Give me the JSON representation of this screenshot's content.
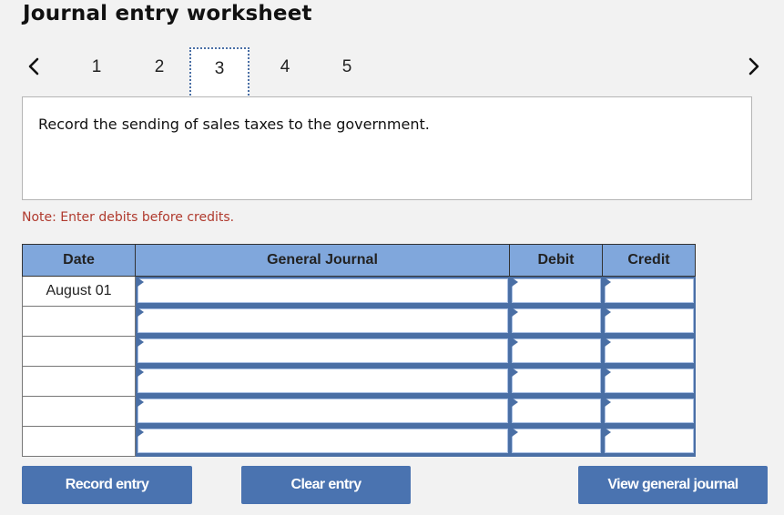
{
  "header": {
    "title": "Journal entry worksheet"
  },
  "pager": {
    "prev_icon": "chevron-left-icon",
    "next_icon": "chevron-right-icon",
    "pages": [
      "1",
      "2",
      "3",
      "4",
      "5"
    ],
    "active_page": "3"
  },
  "prompt": {
    "text": "Record the sending of sales taxes to the government."
  },
  "note": {
    "text": "Note: Enter debits before credits."
  },
  "table": {
    "headers": {
      "date": "Date",
      "general_journal": "General Journal",
      "debit": "Debit",
      "credit": "Credit"
    },
    "rows": [
      {
        "date": "August 01",
        "account": "",
        "debit": "",
        "credit": ""
      },
      {
        "date": "",
        "account": "",
        "debit": "",
        "credit": ""
      },
      {
        "date": "",
        "account": "",
        "debit": "",
        "credit": ""
      },
      {
        "date": "",
        "account": "",
        "debit": "",
        "credit": ""
      },
      {
        "date": "",
        "account": "",
        "debit": "",
        "credit": ""
      },
      {
        "date": "",
        "account": "",
        "debit": "",
        "credit": ""
      }
    ]
  },
  "buttons": {
    "record": "Record entry",
    "clear": "Clear entry",
    "view": "View general journal"
  },
  "colors": {
    "accent": "#4a73b0",
    "header_bg": "#80a7dc",
    "note_text": "#b03a2e",
    "page_bg": "#f2f2f2"
  }
}
